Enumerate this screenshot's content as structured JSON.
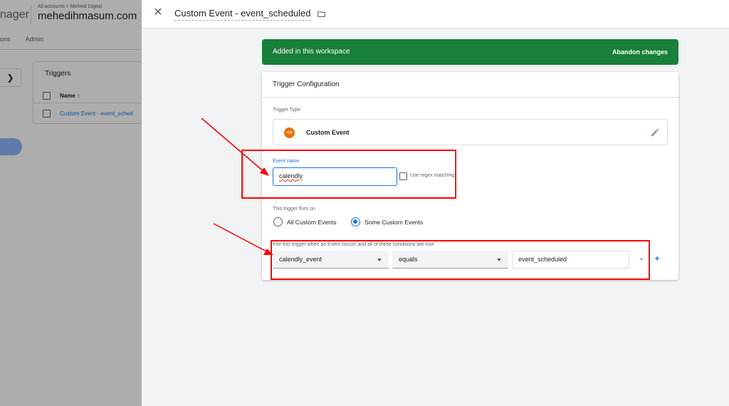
{
  "background_app": {
    "brand_fragment": "nager",
    "breadcrumb": "All accounts > Mehedi Digital",
    "account_name": "mehedihmasum.com",
    "nav": [
      "ons",
      "Admin"
    ],
    "expand_icon": "chevron-right-icon",
    "triggers_card": {
      "title": "Triggers",
      "column_header": "Name ↑",
      "rows": [
        "Custom Event - event_sched"
      ]
    }
  },
  "panel": {
    "close_icon": "close-icon",
    "title": "Custom Event - event_scheduled",
    "folder_icon": "folder-icon"
  },
  "banner": {
    "text": "Added in this workspace",
    "action": "Abandon changes",
    "color": "#188038"
  },
  "trigger_config": {
    "title": "Trigger Configuration",
    "type_label": "Trigger Type",
    "type_name": "Custom Event",
    "type_icon": "code-icon",
    "type_icon_glyph": "<>",
    "edit_icon": "pencil-icon",
    "event_name_label": "Event name",
    "event_name_value": "calendly",
    "regex_label": "Use regex matching",
    "fires_on_label": "This trigger fires on",
    "radio_options": [
      {
        "label": "All Custom Events",
        "selected": false
      },
      {
        "label": "Some Custom Events",
        "selected": true
      }
    ],
    "condition_label": "Fire this trigger when an Event occurs and all of these conditions are true",
    "condition": {
      "variable": "calendly_event",
      "operator": "equals",
      "value": "event_scheduled"
    },
    "remove_label": "-",
    "add_label": "+"
  },
  "colors": {
    "accent": "#1a73e8",
    "annotation": "#ff0000",
    "type_icon_bg": "#e8710a"
  }
}
